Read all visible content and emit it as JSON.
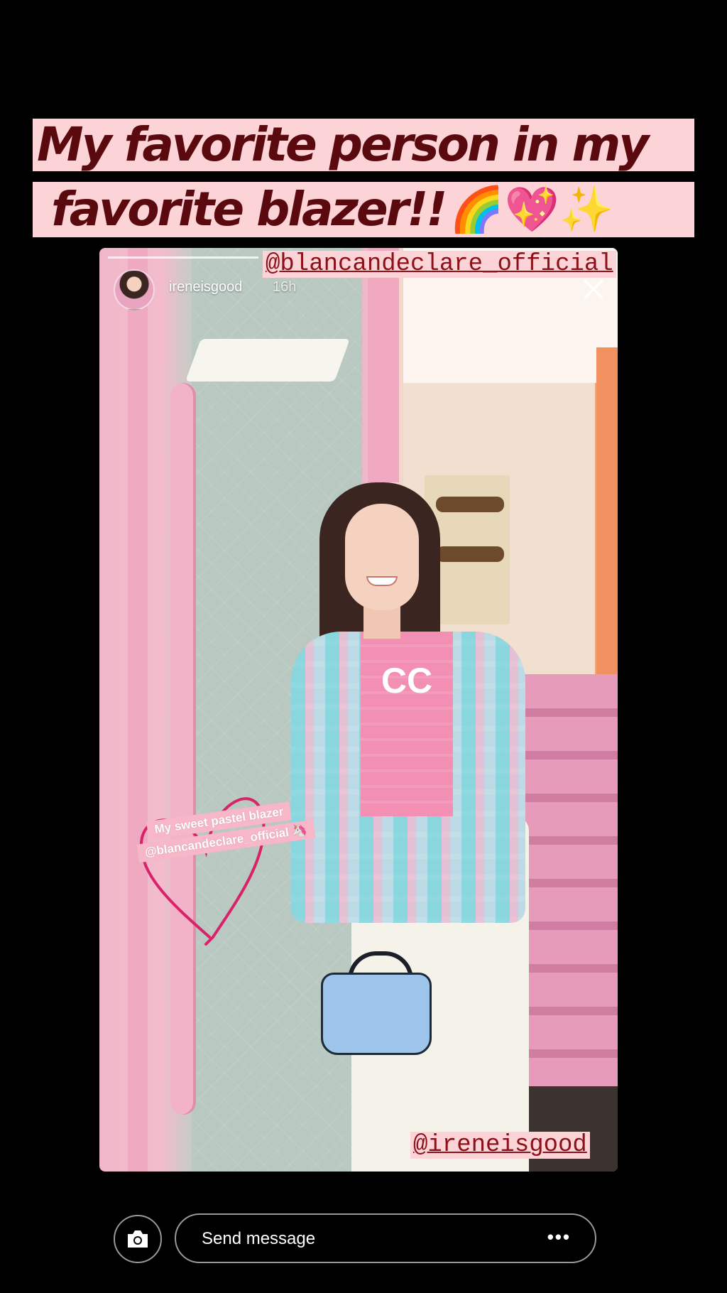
{
  "caption": {
    "line1": "My favorite person in my",
    "line2": "favorite blazer!!",
    "emojis": "🌈💖✨"
  },
  "mentions": {
    "top": "@blancandeclare_official",
    "bottom": "@ireneisgood"
  },
  "story_header": {
    "username": "ireneisgood",
    "timestamp": "16h"
  },
  "sticker": {
    "line1": "My sweet pastel blazer",
    "line2": "@blancandeclare_official 🦄"
  },
  "photo": {
    "shirt_logo": "CC"
  },
  "bottom_bar": {
    "message_placeholder": "Send message",
    "more": "•••"
  },
  "colors": {
    "caption_bg": "#fcd3d6",
    "caption_text": "#5a0a0e",
    "mention_text": "#8b1018"
  },
  "icons": [
    "camera-icon",
    "close-icon",
    "more-icon",
    "heart-doodle-icon"
  ]
}
